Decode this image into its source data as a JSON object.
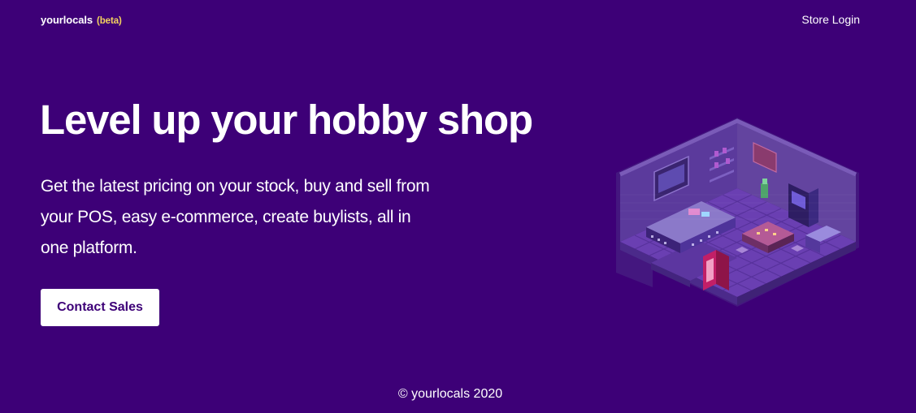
{
  "nav": {
    "brand": "yourlocals",
    "brand_badge": "(beta)",
    "store_login": "Store Login"
  },
  "hero": {
    "title": "Level up your hobby shop",
    "subtitle": "Get the latest pricing on your stock, buy and sell from your POS, easy e-commerce, create buylists, all in one platform.",
    "cta_label": "Contact Sales",
    "illustration": "isometric-hobby-shop-room"
  },
  "footer": {
    "copyright": "© yourlocals 2020"
  },
  "colors": {
    "background": "#3d0077",
    "beta_badge": "#f4d35e",
    "cta_background": "#ffffff",
    "cta_text": "#3d0077",
    "room_floor": "#6a3fb2",
    "room_walls": "#5b3a9c"
  }
}
